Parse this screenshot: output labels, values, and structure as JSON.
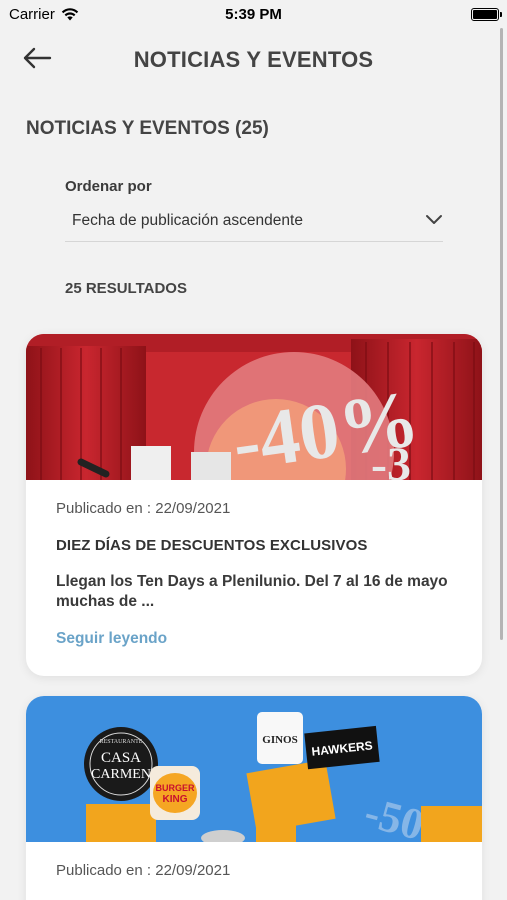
{
  "status_bar": {
    "carrier": "Carrier",
    "time": "5:39 PM"
  },
  "header": {
    "title": "NOTICIAS Y EVENTOS"
  },
  "section_title": "NOTICIAS Y EVENTOS (25)",
  "sort": {
    "label": "Ordenar por",
    "value": "Fecha de publicación ascendente"
  },
  "results_count": "25 RESULTADOS",
  "cards": [
    {
      "date": "Publicado en : 22/09/2021",
      "title": "DIEZ DÍAS DE DESCUENTOS EXCLUSIVOS",
      "description": "Llegan los Ten Days a Plenilunio.   Del 7 al 16 de mayo muchas de ...",
      "link": "Seguir leyendo",
      "image": {
        "text_1": "-40%",
        "text_2": "-3"
      }
    },
    {
      "date": "Publicado en : 22/09/2021",
      "image": {
        "logo_1_top": "RESTAURANTE",
        "logo_1_a": "CASA",
        "logo_1_b": "CARMEN",
        "logo_2_a": "BURGER",
        "logo_2_b": "KING",
        "logo_3": "GINOS",
        "logo_4": "HAWKERS",
        "text_1": "-50%"
      }
    }
  ],
  "colors": {
    "link": "#6aa3c8",
    "background": "#f2f2f2",
    "card_1_image_bg": "#c8282f",
    "card_2_image_bg": "#3d8fdf"
  }
}
